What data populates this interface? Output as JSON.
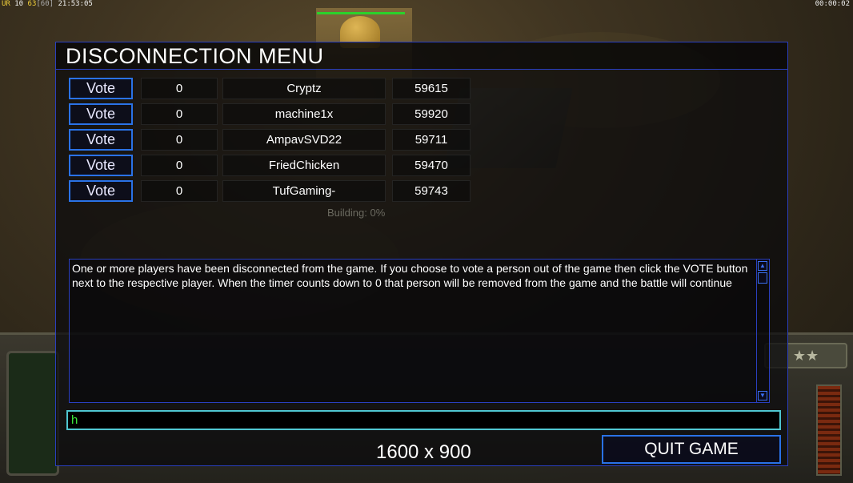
{
  "status_bar": {
    "left_prefix": "UR",
    "left_a": "10",
    "left_b": "63",
    "left_c": "[60]",
    "left_time": "21:53:05",
    "right_time": "00:00:02"
  },
  "dialog": {
    "title": "DISCONNECTION MENU",
    "players": [
      {
        "vote_label": "Vote",
        "votes": "0",
        "name": "Cryptz",
        "ping": "59615"
      },
      {
        "vote_label": "Vote",
        "votes": "0",
        "name": "machine1x",
        "ping": "59920"
      },
      {
        "vote_label": "Vote",
        "votes": "0",
        "name": "AmpavSVD22",
        "ping": "59711"
      },
      {
        "vote_label": "Vote",
        "votes": "0",
        "name": "FriedChicken",
        "ping": "59470"
      },
      {
        "vote_label": "Vote",
        "votes": "0",
        "name": "TufGaming-",
        "ping": "59743"
      }
    ],
    "building_label": "Building: 0%",
    "message": "One or more players have been disconnected from the game. If you choose to vote a person out of the game then click the VOTE button next to the respective player. When the timer counts down to 0 that person will be removed from the game and the battle will continue",
    "chat_input_value": "h",
    "resolution_label": "1600 x 900",
    "quit_label": "QUIT GAME"
  },
  "hud": {
    "stars": "★★"
  },
  "colors": {
    "accent_blue": "#2a72e6",
    "border_blue": "#2a3fbf",
    "chat_border": "#4fc6d0",
    "chat_text": "#3ce83c"
  }
}
